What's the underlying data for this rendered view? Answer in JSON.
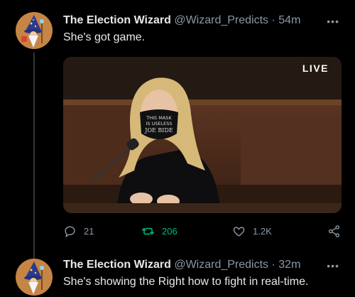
{
  "tweets": [
    {
      "display_name": "The Election Wizard",
      "handle": "@Wizard_Predicts",
      "time": "· 54m",
      "text": "She's got game.",
      "media": {
        "live_label": "LIVE",
        "mask_text": [
          "THIS MASK",
          "IS USELESS",
          "JOE BIDE"
        ]
      },
      "stats": {
        "replies": "21",
        "retweets": "206",
        "likes": "1.2K"
      },
      "more": "•••"
    },
    {
      "display_name": "The Election Wizard",
      "handle": "@Wizard_Predicts",
      "time": "· 32m",
      "text": "She's showing the Right how to fight in real-time.",
      "more": "•••"
    }
  ],
  "colors": {
    "background": "#000000",
    "text": "#e7e9ea",
    "muted": "#8b98a5",
    "retweet_active": "#00ba7c",
    "thread_line": "#333639"
  },
  "icons": [
    "wizard-avatar-icon",
    "more-icon",
    "reply-icon",
    "retweet-icon",
    "like-icon",
    "share-icon"
  ]
}
